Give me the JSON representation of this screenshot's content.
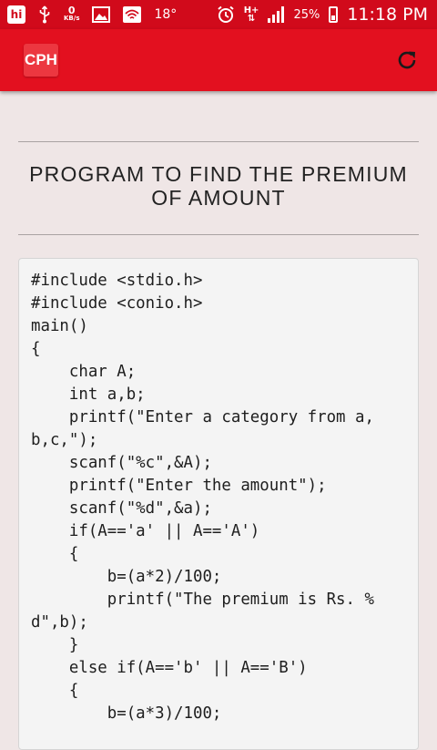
{
  "status_bar": {
    "notification_icon": "hi",
    "data_rate_value": "0",
    "data_rate_unit": "KB/s",
    "temperature": "18°",
    "network_type_top": "H+",
    "network_type_bottom": "⇅",
    "battery_percent": "25%",
    "time": "11:18 PM"
  },
  "app_bar": {
    "logo_text": "CPH",
    "refresh_icon": "refresh-icon"
  },
  "page": {
    "title": "PROGRAM TO FIND THE PREMIUM OF AMOUNT",
    "code_lines": [
      "#include <stdio.h>",
      "#include <conio.h>",
      "main()",
      "{",
      "    char A;",
      "    int a,b;",
      "    printf(\"Enter a category from a,",
      "b,c,\");",
      "    scanf(\"%c\",&A);",
      "    printf(\"Enter the amount\");",
      "    scanf(\"%d\",&a);",
      "    if(A=='a' || A=='A')",
      "    {",
      "        b=(a*2)/100;",
      "        printf(\"The premium is Rs. %",
      "d\",b);",
      "    }",
      "    else if(A=='b' || A=='B')",
      "    {",
      "        b=(a*3)/100;"
    ]
  }
}
